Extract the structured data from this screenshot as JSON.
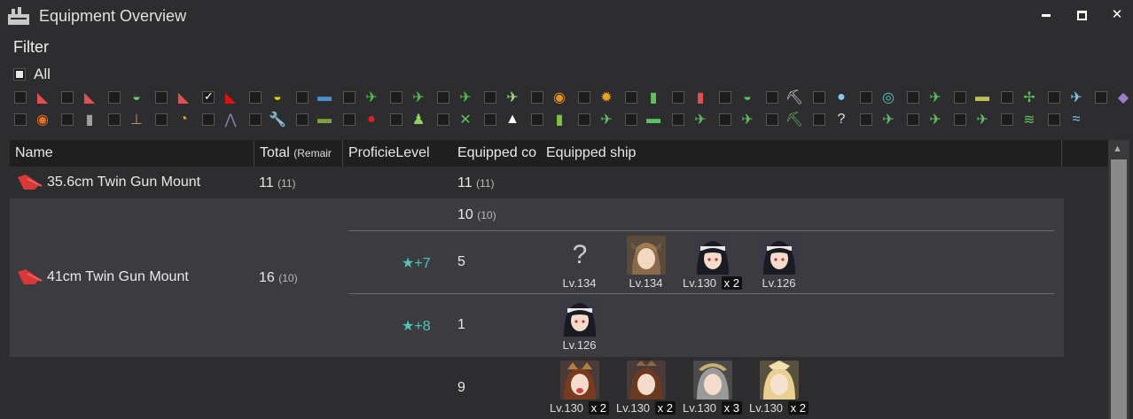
{
  "window": {
    "title": "Equipment Overview",
    "minimize": "▁",
    "maximize": "▢",
    "close": "✕"
  },
  "filter": {
    "label": "Filter",
    "all_label": "All",
    "row1": [
      {
        "icon": "main-gun-small-icon",
        "color": "#e05050",
        "glyph": "◣",
        "checked": false
      },
      {
        "icon": "main-gun-medium-icon",
        "color": "#e05050",
        "glyph": "◣",
        "checked": false
      },
      {
        "icon": "secondary-gun-icon",
        "color": "#6cd06c",
        "glyph": "◒",
        "checked": false
      },
      {
        "icon": "main-gun-large-icon",
        "color": "#e05050",
        "glyph": "◣",
        "checked": false
      },
      {
        "icon": "main-gun-large-red-icon",
        "color": "#e01010",
        "glyph": "◣",
        "checked": true
      },
      {
        "icon": "secondary-yellow-gun-icon",
        "color": "#f0d000",
        "glyph": "◒",
        "checked": false
      },
      {
        "icon": "torpedo-icon",
        "color": "#4a90d0",
        "glyph": "▬",
        "checked": false
      },
      {
        "icon": "fighter-icon",
        "color": "#4fc04f",
        "glyph": "✈",
        "checked": false
      },
      {
        "icon": "bomber-icon",
        "color": "#4fc04f",
        "glyph": "✈",
        "checked": false
      },
      {
        "icon": "torpedo-bomber-icon",
        "color": "#4fc04f",
        "glyph": "✈",
        "checked": false
      },
      {
        "icon": "recon-plane-icon",
        "color": "#9ee07a",
        "glyph": "✈",
        "checked": false
      },
      {
        "icon": "radar-icon",
        "color": "#e89020",
        "glyph": "◉",
        "checked": false
      },
      {
        "icon": "engine-icon",
        "color": "#f0a020",
        "glyph": "✹",
        "checked": false
      },
      {
        "icon": "ammo-icon",
        "color": "#60c060",
        "glyph": "▮",
        "checked": false
      },
      {
        "icon": "shell-icon",
        "color": "#e05050",
        "glyph": "▮",
        "checked": false
      },
      {
        "icon": "aa-gun-icon",
        "color": "#60c060",
        "glyph": "◒",
        "checked": false
      },
      {
        "icon": "pickaxe-icon",
        "color": "#e0e0e0",
        "glyph": "⛏",
        "checked": false
      },
      {
        "icon": "depth-charge-icon",
        "color": "#80c8f0",
        "glyph": "●",
        "checked": false
      },
      {
        "icon": "sonar-icon",
        "color": "#4fc4b8",
        "glyph": "◎",
        "checked": false
      },
      {
        "icon": "seaplane-icon",
        "color": "#60c060",
        "glyph": "✈",
        "checked": false
      },
      {
        "icon": "landing-craft-icon",
        "color": "#c0c050",
        "glyph": "▬",
        "checked": false
      },
      {
        "icon": "autogyro-icon",
        "color": "#60c060",
        "glyph": "✢",
        "checked": false
      },
      {
        "icon": "patrol-plane-icon",
        "color": "#80c8f0",
        "glyph": "✈",
        "checked": false
      },
      {
        "icon": "eraser-icon",
        "color": "#9b7cc8",
        "glyph": "◆",
        "checked": false
      }
    ],
    "row2": [
      {
        "icon": "lamp-icon",
        "color": "#e87020",
        "glyph": "◉",
        "checked": false
      },
      {
        "icon": "drum-icon",
        "color": "#a0a0a0",
        "glyph": "▮",
        "checked": false
      },
      {
        "icon": "crane-icon",
        "color": "#c09070",
        "glyph": "⊥",
        "checked": false
      },
      {
        "icon": "searchlight-icon",
        "color": "#f0a020",
        "glyph": "◔",
        "checked": false
      },
      {
        "icon": "antenna-icon",
        "color": "#9080b0",
        "glyph": "⋀",
        "checked": false
      },
      {
        "icon": "wrench-icon",
        "color": "#d09060",
        "glyph": "🔧",
        "checked": false
      },
      {
        "icon": "tank-icon",
        "color": "#80a040",
        "glyph": "▬",
        "checked": false
      },
      {
        "icon": "ration-icon",
        "color": "#e02020",
        "glyph": "●",
        "checked": false
      },
      {
        "icon": "personnel-icon",
        "color": "#8fd060",
        "glyph": "♟",
        "checked": false
      },
      {
        "icon": "jet-icon",
        "color": "#60c060",
        "glyph": "✕",
        "checked": false
      },
      {
        "icon": "onigiri-icon",
        "color": "#ffffff",
        "glyph": "▲",
        "checked": false
      },
      {
        "icon": "fuel-drum-icon",
        "color": "#80c040",
        "glyph": "▮",
        "checked": false
      },
      {
        "icon": "night-plane-icon",
        "color": "#60c060",
        "glyph": "✈",
        "checked": false
      },
      {
        "icon": "submarine-equip-icon",
        "color": "#60c060",
        "glyph": "▬",
        "checked": false
      },
      {
        "icon": "interceptor-icon",
        "color": "#60c060",
        "glyph": "✈",
        "checked": false
      },
      {
        "icon": "land-attacker-icon",
        "color": "#60c060",
        "glyph": "✈",
        "checked": false
      },
      {
        "icon": "pickaxe-green-icon",
        "color": "#60c060",
        "glyph": "⛏",
        "checked": false
      },
      {
        "icon": "unknown-icon",
        "color": "#e0e0e0",
        "glyph": "?",
        "checked": false
      },
      {
        "icon": "jet-fighter-icon",
        "color": "#60c060",
        "glyph": "✈",
        "checked": false
      },
      {
        "icon": "jet-bomber-icon",
        "color": "#60c060",
        "glyph": "✈",
        "checked": false
      },
      {
        "icon": "heavy-aircraft-icon",
        "color": "#60c060",
        "glyph": "✈",
        "checked": false
      },
      {
        "icon": "flying-boat-icon",
        "color": "#60c060",
        "glyph": "≋",
        "checked": false
      },
      {
        "icon": "water-icon",
        "color": "#80c8f0",
        "glyph": "≈",
        "checked": false
      }
    ]
  },
  "grid": {
    "headers": [
      "Name",
      "Total (Remair",
      "Proficie",
      "Level",
      "Equipped co",
      "Equipped ship"
    ],
    "header_total_main": "Total",
    "header_total_sub": "(Remair",
    "rows": [
      {
        "name": "35.6cm Twin Gun Mount",
        "icon_color": "#e04040",
        "total": "11",
        "remain": "(11)",
        "groups": [
          {
            "count": "11",
            "remain": "(11)",
            "level": "",
            "ships": []
          }
        ]
      },
      {
        "name": "41cm Twin Gun Mount",
        "icon_color": "#e04040",
        "total": "16",
        "remain": "(10)",
        "groups": [
          {
            "count": "10",
            "remain": "(10)",
            "level": "",
            "ships": []
          },
          {
            "count": "5",
            "remain": "",
            "level": "★+7",
            "ships": [
              {
                "level": "Lv.134",
                "mult": "",
                "portrait": "unknown"
              },
              {
                "level": "Lv.134",
                "mult": "",
                "portrait": "brown-hair-girl"
              },
              {
                "level": "Lv.130",
                "mult": "x 2",
                "portrait": "black-hair-girl"
              },
              {
                "level": "Lv.126",
                "mult": "",
                "portrait": "black-hair-girl"
              }
            ]
          },
          {
            "count": "1",
            "remain": "",
            "level": "★+8",
            "ships": [
              {
                "level": "Lv.126",
                "mult": "",
                "portrait": "black-hair-girl"
              }
            ]
          }
        ]
      },
      {
        "name": "",
        "icon_color": "",
        "total": "",
        "remain": "",
        "groups": [
          {
            "count": "9",
            "remain": "",
            "level": "",
            "ships": [
              {
                "level": "Lv.130",
                "mult": "x 2",
                "portrait": "brown-hair-headgear-girl"
              },
              {
                "level": "Lv.130",
                "mult": "x 2",
                "portrait": "brown-hair-girl"
              },
              {
                "level": "Lv.130",
                "mult": "x 3",
                "portrait": "grey-hair-girl"
              },
              {
                "level": "Lv.130",
                "mult": "x 2",
                "portrait": "blonde-hair-girl"
              }
            ]
          }
        ]
      }
    ]
  },
  "unknown_glyph": "?"
}
